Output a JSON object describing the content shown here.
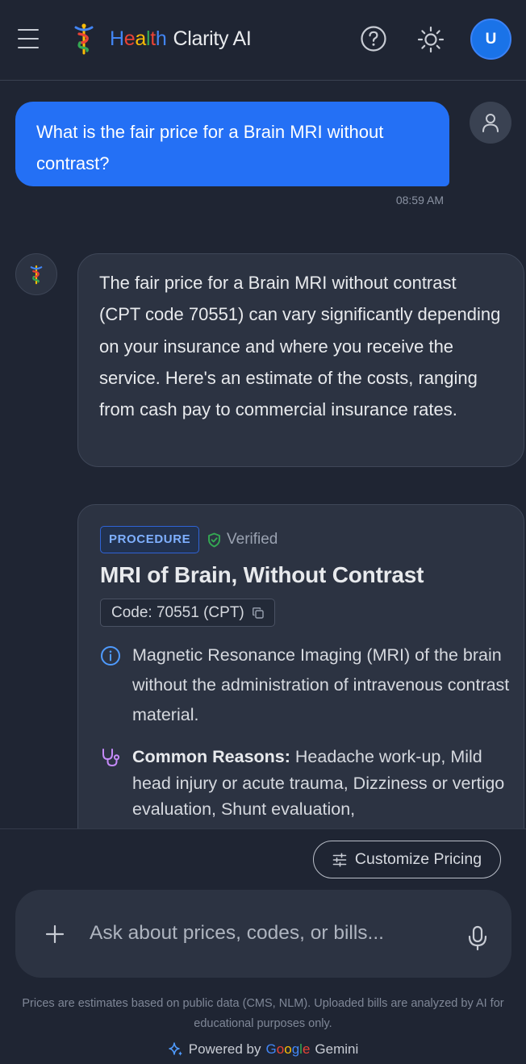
{
  "header": {
    "brand": {
      "letters": [
        "H",
        "e",
        "a",
        "l",
        "t",
        "h"
      ],
      "rest": "Clarity AI"
    },
    "avatar_initial": "U"
  },
  "colors": {
    "background": "#1f2533",
    "user_bubble": "#2470f5",
    "bot_bubble": "#2c3342",
    "badge_text": "#7fb0ff",
    "verified_green": "#34a853",
    "reason_icon": "#c58af9"
  },
  "messages": {
    "user": {
      "text": "What is the fair price for a Brain MRI without contrast?",
      "time": "08:59 AM"
    },
    "bot": {
      "text": "The fair price for a Brain MRI without contrast (CPT code 70551) can vary significantly depending on your insurance and where you receive the service. Here's an estimate of the costs, ranging from cash pay to commercial insurance rates."
    }
  },
  "procedure_card": {
    "badge": "PROCEDURE",
    "verified_label": "Verified",
    "title": "MRI of Brain, Without Contrast",
    "code_label": "Code: 70551 (CPT)",
    "description": "Magnetic Resonance Imaging (MRI) of the brain without the administration of intravenous contrast material.",
    "reasons_label": "Common Reasons:",
    "reasons_text": "Headache work-up, Mild head injury or acute trauma, Dizziness or vertigo evaluation, Shunt evaluation,"
  },
  "composer": {
    "customize_label": "Customize Pricing",
    "placeholder": "Ask about prices, codes, or bills..."
  },
  "footer": {
    "disclaimer": "Prices are estimates based on public data (CMS, NLM). Uploaded bills are analyzed by AI for educational purposes only.",
    "powered_by": "Powered by",
    "google_letters": [
      "G",
      "o",
      "o",
      "g",
      "l",
      "e"
    ],
    "gemini": "Gemini"
  },
  "icons": {
    "menu": "menu-icon",
    "help": "help-circle-icon",
    "theme": "sun-icon",
    "user": "person-icon",
    "verified": "shield-check-icon",
    "copy": "copy-icon",
    "info": "info-icon",
    "reasons": "stethoscope-icon",
    "sliders": "sliders-icon",
    "plus": "plus-icon",
    "mic": "mic-icon",
    "sparkle": "sparkle-icon"
  }
}
